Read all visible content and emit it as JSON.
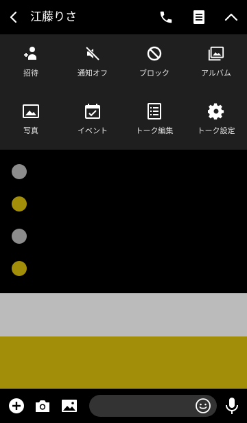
{
  "header": {
    "title": "江藤りさ",
    "icons": {
      "back": "chevron-left-icon",
      "call": "phone-icon",
      "notes": "note-icon",
      "collapse": "chevron-up-icon"
    }
  },
  "menu": {
    "items": [
      {
        "label": "招待",
        "icon": "invite-icon"
      },
      {
        "label": "通知オフ",
        "icon": "mute-icon"
      },
      {
        "label": "ブロック",
        "icon": "block-icon"
      },
      {
        "label": "アルバム",
        "icon": "album-icon"
      },
      {
        "label": "写真",
        "icon": "photo-icon"
      },
      {
        "label": "イベント",
        "icon": "event-calendar-icon"
      },
      {
        "label": "トーク編集",
        "icon": "edit-list-icon"
      },
      {
        "label": "トーク設定",
        "icon": "gear-icon"
      }
    ]
  },
  "theme": {
    "dot_colors": [
      "#8c8c8c",
      "#a38e0a",
      "#8c8c8c",
      "#a38e0a"
    ],
    "band_gray": "#bbbbbb",
    "band_olive": "#a38e0a",
    "background": "#000000",
    "menu_background": "#1f1f1f",
    "input_background": "#333333"
  },
  "input_bar": {
    "message_placeholder": "",
    "icons": {
      "add": "plus-circle-icon",
      "camera": "camera-icon",
      "image": "image-icon",
      "emoji": "emoji-icon",
      "mic": "microphone-icon"
    }
  }
}
